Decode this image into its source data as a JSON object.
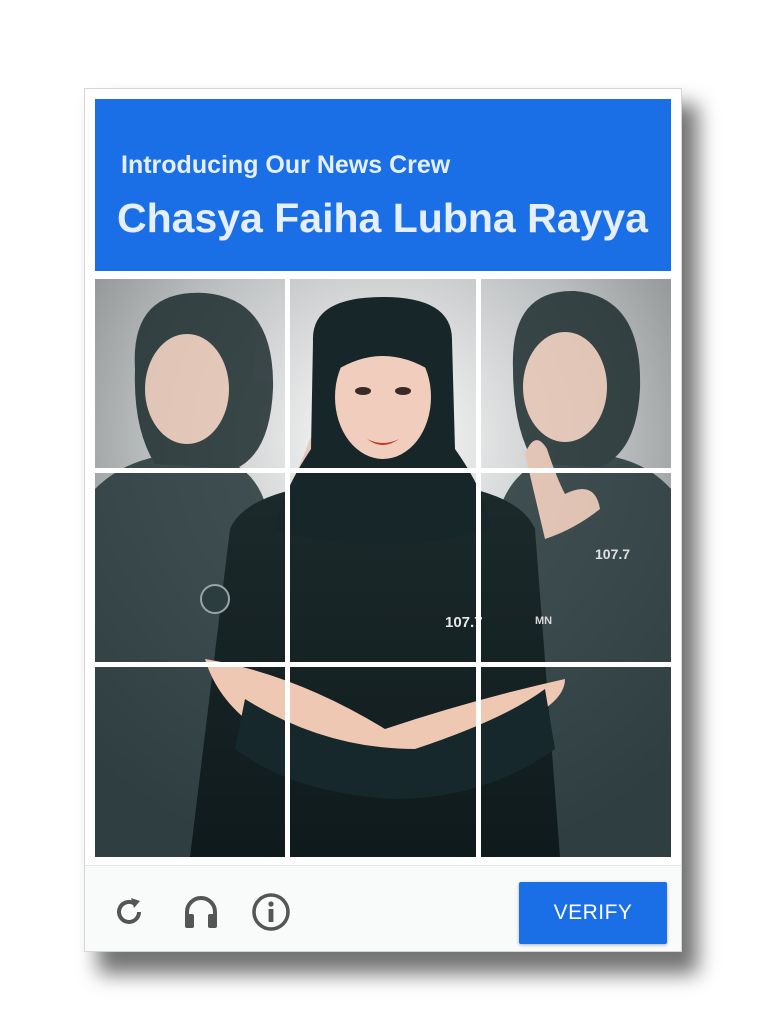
{
  "header": {
    "subtitle": "Introducing Our News Crew",
    "title": "Chasya Faiha Lubna Rayya"
  },
  "grid": {
    "rows": 3,
    "cols": 3
  },
  "photo": {
    "shirt_patch_text": "107.7",
    "logo_text": "MN"
  },
  "footer": {
    "icons": [
      "reload-icon",
      "headphones-icon",
      "info-icon"
    ],
    "verify_label": "VERIFY"
  },
  "colors": {
    "accent": "#1a6fe6",
    "header_text": "#e6efff",
    "icon": "#555555"
  }
}
